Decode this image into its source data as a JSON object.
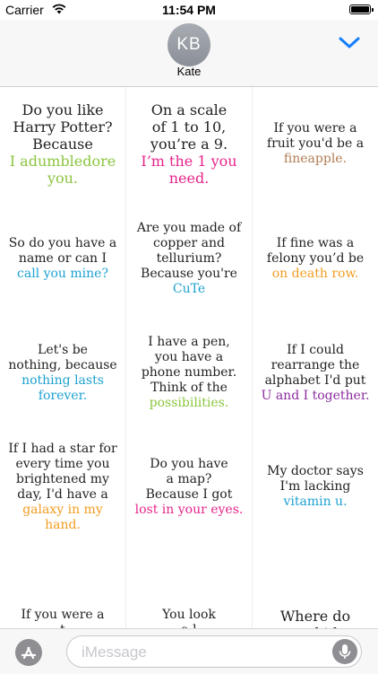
{
  "status_bar": {
    "carrier": "Carrier",
    "time": "11:54 PM"
  },
  "header": {
    "avatar_initials": "KB",
    "contact_name": "Kate"
  },
  "colors": {
    "green": "#8bc53f",
    "pink": "#e6258a",
    "brown": "#b07b52",
    "cyan": "#1da1d1",
    "orange": "#f39c1f",
    "purple": "#8a2b9e",
    "text": "#222222",
    "ios_blue": "#147efb"
  },
  "stickers": [
    {
      "setup": [
        "Do you like",
        "Harry Potter?",
        "Because"
      ],
      "punch": [
        "I adumbledore",
        "you."
      ],
      "color": "#8bc53f",
      "style": "big"
    },
    {
      "setup": [
        "On a scale",
        "of 1 to 10,",
        "you’re a 9."
      ],
      "punch": [
        "I’m the 1 you",
        "need."
      ],
      "color": "#e6258a",
      "style": "big"
    },
    {
      "setup": [
        "If you were a",
        "fruit you'd be a"
      ],
      "punch": [
        "fineapple."
      ],
      "color": "#b07b52",
      "style": "normal"
    },
    {
      "setup": [
        "So do you have a",
        "name or can I"
      ],
      "punch": [
        "call you mine?"
      ],
      "color": "#1da1d1",
      "style": "normal"
    },
    {
      "setup": [
        "Are you made of",
        "copper and",
        "tellurium?",
        "Because you're"
      ],
      "punch": [
        "CuTe"
      ],
      "color": "#1da1d1",
      "style": "normal"
    },
    {
      "setup": [
        "If fine was a",
        "felony you’d be"
      ],
      "punch": [
        "on death row."
      ],
      "color": "#f39c1f",
      "style": "normal"
    },
    {
      "setup": [
        "Let's be",
        "nothing, because"
      ],
      "punch": [
        "nothing lasts",
        "forever."
      ],
      "color": "#1da1d1",
      "style": "normal"
    },
    {
      "setup": [
        "I have a pen,",
        "you have a",
        "phone number.",
        "Think of the"
      ],
      "punch": [
        "possibilities."
      ],
      "color": "#8bc53f",
      "style": "normal"
    },
    {
      "setup": [
        "If I could",
        "rearrange the",
        "alphabet I'd put"
      ],
      "punch": [
        "U and I together."
      ],
      "color": "#8a2b9e",
      "style": "normal"
    },
    {
      "setup": [
        "If I had a star for",
        "every time you",
        "brightened my",
        "day, I'd have a"
      ],
      "punch": [
        "galaxy in my",
        "hand."
      ],
      "color": "#f39c1f",
      "style": "normal"
    },
    {
      "setup": [
        "Do you have",
        "a map?",
        "Because I got"
      ],
      "punch": [
        "lost in your eyes."
      ],
      "color": "#e6258a",
      "style": "normal"
    },
    {
      "setup": [
        "My doctor says",
        "I'm lacking"
      ],
      "punch": [
        "vitamin u."
      ],
      "color": "#1da1d1",
      "style": "normal"
    },
    {
      "setup": [
        "If you were a",
        "t"
      ],
      "punch": [],
      "color": "#222222",
      "style": "normal"
    },
    {
      "setup": [
        "You look",
        "a l"
      ],
      "punch": [],
      "color": "#222222",
      "style": "normal"
    },
    {
      "setup": [
        "Where do",
        "you hide"
      ],
      "punch": [],
      "color": "#222222",
      "style": "big"
    }
  ],
  "input_bar": {
    "placeholder": "iMessage",
    "value": ""
  },
  "icons": {
    "wifi": "wifi-icon",
    "battery": "battery-icon",
    "chevron": "chevron-down-icon",
    "app_store": "app-store-icon",
    "mic": "microphone-icon"
  }
}
